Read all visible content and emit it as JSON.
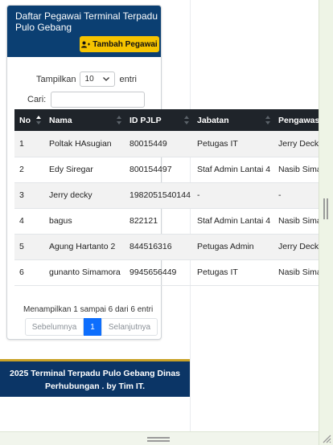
{
  "card": {
    "title": "Daftar Pegawai Terminal Terpadu Pulo Gebang",
    "add_button_label": "Tambah Pegawai"
  },
  "length_control": {
    "prefix": "Tampilkan",
    "selected": "10",
    "suffix": "entri"
  },
  "search": {
    "label": "Cari:",
    "value": ""
  },
  "table": {
    "columns": [
      "No",
      "Nama",
      "ID PJLP",
      "Jabatan",
      "Pengawas"
    ],
    "rows": [
      [
        "1",
        "Poltak HAsugian",
        "80015449",
        "Petugas IT",
        "Jerry Decky"
      ],
      [
        "2",
        "Edy Siregar",
        "800154497",
        "Staf Admin Lantai 4",
        "Nasib Sima"
      ],
      [
        "3",
        "Jerry decky",
        "1982051540144",
        "-",
        "-"
      ],
      [
        "4",
        "bagus",
        "822121",
        "Staf Admin Lantai 4",
        "Nasib Sima"
      ],
      [
        "5",
        "Agung Hartanto 2",
        "844516316",
        "Petugas Admin",
        "Jerry Decky"
      ],
      [
        "6",
        "gunanto Simamora",
        "9945656449",
        "Petugas IT",
        "Nasib Sima"
      ]
    ]
  },
  "info_text": "Menampilkan 1 sampai 6 dari 6 entri",
  "pagination": {
    "prev": "Sebelumnya",
    "current": "1",
    "next": "Selanjutnya"
  },
  "footer": {
    "line1": "2025 Terminal Terpadu Pulo Gebang Dinas",
    "line2": "Perhubungan . by Tim IT."
  },
  "colors": {
    "header_bg": "#0b3f72",
    "accent_button": "#f6c400",
    "table_head": "#1f242a",
    "pager_active": "#0d6efd",
    "footer_bg": "#0b3566"
  }
}
